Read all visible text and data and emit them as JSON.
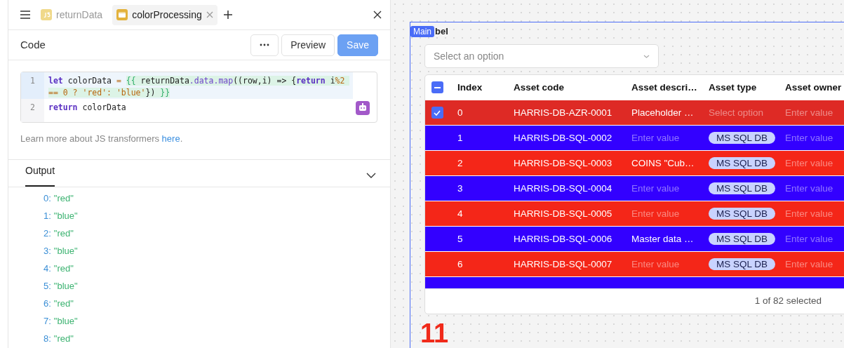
{
  "tabs": [
    {
      "label": "returnData",
      "selected": false,
      "closable": false
    },
    {
      "label": "colorProcessing",
      "selected": true,
      "closable": true
    }
  ],
  "code_panel": {
    "title": "Code",
    "buttons": [
      {
        "kind": "more"
      },
      {
        "kind": "text",
        "label": "Preview",
        "disabled": false
      },
      {
        "kind": "primary",
        "label": "Save",
        "disabled": true
      }
    ],
    "lines": [
      {
        "number": "1",
        "highlighted": true,
        "tokens": [
          {
            "kind": "keyword",
            "text": "let"
          },
          {
            "kind": "plain",
            "text": " colorData "
          },
          {
            "kind": "operator",
            "text": "= "
          },
          {
            "kind": "binding",
            "tokens": [
              {
                "kind": "brace",
                "text": "{{"
              },
              {
                "kind": "plain",
                "text": " returnData"
              },
              {
                "kind": "property",
                "text": ".data.map"
              },
              {
                "kind": "plain",
                "text": "((row,i) => {"
              },
              {
                "kind": "keyword",
                "text": "return"
              },
              {
                "kind": "plain",
                "text": " i"
              },
              {
                "kind": "operator",
                "text": "%2 == 0 ? 'red': 'blue'"
              },
              {
                "kind": "plain",
                "text": "})"
              },
              {
                "kind": "brace",
                "text": " }}"
              }
            ]
          }
        ]
      },
      {
        "number": "2",
        "highlighted": false,
        "tokens": [
          {
            "kind": "keyword",
            "text": "return"
          },
          {
            "kind": "plain",
            "text": " colorData"
          }
        ]
      }
    ],
    "help_text": "Learn more about JS transformers ",
    "help_link": "here",
    "help_end": "."
  },
  "output_panel": {
    "tab": {
      "label": "Output",
      "selected": true
    },
    "expanded": true,
    "items": [
      {
        "key": "0:",
        "value": "\"red\""
      },
      {
        "key": "1:",
        "value": "\"blue\""
      },
      {
        "key": "2:",
        "value": "\"red\""
      },
      {
        "key": "3:",
        "value": "\"blue\""
      },
      {
        "key": "4:",
        "value": "\"red\""
      },
      {
        "key": "5:",
        "value": "\"blue\""
      },
      {
        "key": "6:",
        "value": "\"red\""
      },
      {
        "key": "7:",
        "value": "\"blue\""
      },
      {
        "key": "8:",
        "value": "\"red\""
      }
    ]
  },
  "canvas": {
    "frame_badge": "Main",
    "label": "bel",
    "select": {
      "placeholder": "Select an option"
    },
    "table": {
      "select_all": {
        "indeterminate": true
      },
      "columns": [
        "Index",
        "Asset code",
        "Asset descri…",
        "Asset type",
        "Asset owner"
      ],
      "rows": [
        {
          "selected": true,
          "color": "#de2a25",
          "cells": [
            {
              "kind": "text",
              "text": "0"
            },
            {
              "kind": "text",
              "text": "HARRIS-DB-AZR-0001"
            },
            {
              "kind": "text",
              "text": "Placeholder …"
            },
            {
              "kind": "placeholder",
              "text": "Select option"
            },
            {
              "kind": "placeholder",
              "text": "Enter value"
            }
          ]
        },
        {
          "selected": false,
          "color": "#3300ff",
          "cells": [
            {
              "kind": "text",
              "text": "1"
            },
            {
              "kind": "text",
              "text": "HARRIS-DB-SQL-0002"
            },
            {
              "kind": "placeholder",
              "text": "Enter value"
            },
            {
              "kind": "tag",
              "text": "MS SQL DB"
            },
            {
              "kind": "placeholder",
              "text": "Enter value"
            }
          ]
        },
        {
          "selected": false,
          "color": "#f42618",
          "cells": [
            {
              "kind": "text",
              "text": "2"
            },
            {
              "kind": "text",
              "text": "HARRIS-DB-SQL-0003"
            },
            {
              "kind": "text",
              "text": "COINS \"Cub…"
            },
            {
              "kind": "tag",
              "text": "MS SQL DB"
            },
            {
              "kind": "placeholder",
              "text": "Enter value"
            }
          ]
        },
        {
          "selected": false,
          "color": "#3300ff",
          "cells": [
            {
              "kind": "text",
              "text": "3"
            },
            {
              "kind": "text",
              "text": "HARRIS-DB-SQL-0004"
            },
            {
              "kind": "placeholder",
              "text": "Enter value"
            },
            {
              "kind": "tag",
              "text": "MS SQL DB"
            },
            {
              "kind": "placeholder",
              "text": "Enter value"
            }
          ]
        },
        {
          "selected": false,
          "color": "#f42618",
          "cells": [
            {
              "kind": "text",
              "text": "4"
            },
            {
              "kind": "text",
              "text": "HARRIS-DB-SQL-0005"
            },
            {
              "kind": "placeholder",
              "text": "Enter value"
            },
            {
              "kind": "tag",
              "text": "MS SQL DB"
            },
            {
              "kind": "placeholder",
              "text": "Enter value"
            }
          ]
        },
        {
          "selected": false,
          "color": "#3300ff",
          "cells": [
            {
              "kind": "text",
              "text": "5"
            },
            {
              "kind": "text",
              "text": "HARRIS-DB-SQL-0006"
            },
            {
              "kind": "text",
              "text": "Master data …"
            },
            {
              "kind": "tag",
              "text": "MS SQL DB"
            },
            {
              "kind": "placeholder",
              "text": "Enter value"
            }
          ]
        },
        {
          "selected": false,
          "color": "#f42618",
          "cells": [
            {
              "kind": "text",
              "text": "6"
            },
            {
              "kind": "text",
              "text": "HARRIS-DB-SQL-0007"
            },
            {
              "kind": "placeholder",
              "text": "Enter value"
            },
            {
              "kind": "tag",
              "text": "MS SQL DB"
            },
            {
              "kind": "placeholder",
              "text": "Enter value"
            }
          ]
        },
        {
          "selected": false,
          "color": "#3300ff",
          "cells": []
        }
      ],
      "footer": "1 of 82 selected"
    },
    "big_number": "11"
  }
}
